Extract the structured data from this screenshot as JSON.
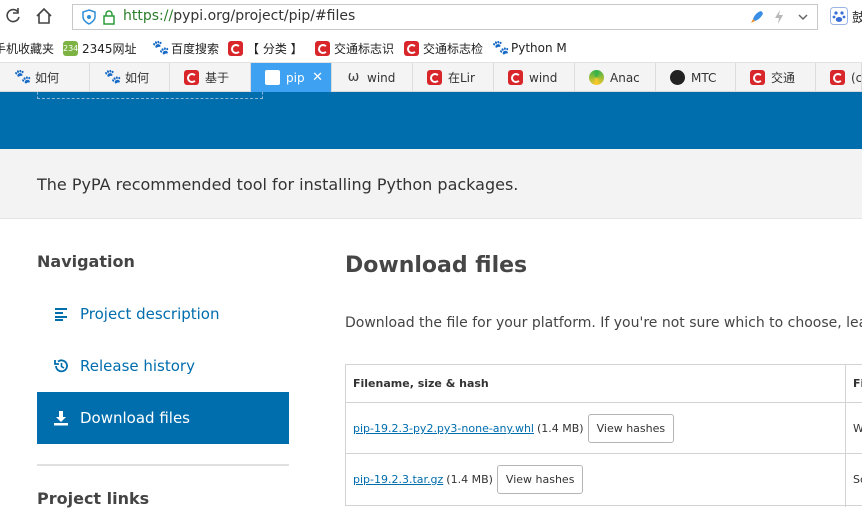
{
  "browser": {
    "url_protocol": "https://",
    "url_rest": "pypi.org/project/pip/#files",
    "right_edge_text": "鼓"
  },
  "bookmarks": [
    {
      "label": "手机收藏夹",
      "icon": "none"
    },
    {
      "label": "2345网址",
      "icon": "2345-icon"
    },
    {
      "label": "百度搜索",
      "icon": "baidu-paw-icon"
    },
    {
      "label": "【 分类 】",
      "icon": "csdn-icon"
    },
    {
      "label": "交通标志识",
      "icon": "csdn-icon"
    },
    {
      "label": "交通标志检",
      "icon": "csdn-icon"
    },
    {
      "label": "Python M",
      "icon": "baidu-paw-icon"
    }
  ],
  "tabs": [
    {
      "label": "如何",
      "icon": "baidu-paw-icon"
    },
    {
      "label": "如何",
      "icon": "baidu-paw-icon"
    },
    {
      "label": "基于",
      "icon": "csdn-icon"
    },
    {
      "label": "pip",
      "icon": "pypi-cube-icon"
    },
    {
      "label": "wind",
      "icon": "w-icon"
    },
    {
      "label": "在Lir",
      "icon": "csdn-icon"
    },
    {
      "label": "wind",
      "icon": "csdn-icon"
    },
    {
      "label": "Anac",
      "icon": "anaconda-icon"
    },
    {
      "label": "MTC",
      "icon": "github-icon"
    },
    {
      "label": "交通",
      "icon": "csdn-icon"
    },
    {
      "label": "(c",
      "icon": "csdn-icon"
    }
  ],
  "page": {
    "summary": "The PyPA recommended tool for installing Python packages.",
    "navigation": {
      "title": "Navigation",
      "items": [
        {
          "label": "Project description",
          "icon": "align-left-icon"
        },
        {
          "label": "Release history",
          "icon": "history-icon"
        },
        {
          "label": "Download files",
          "icon": "download-icon"
        }
      ]
    },
    "project_links_title": "Project links",
    "download": {
      "title": "Download files",
      "subtitle": "Download the file for your platform. If you're not sure which to choose, learn r",
      "columns": [
        "Filename, size & hash",
        "Fi"
      ],
      "rows": [
        {
          "filename": "pip-19.2.3-py2.py3-none-any.whl",
          "size": "(1.4 MB)",
          "button": "View hashes",
          "type": "W"
        },
        {
          "filename": "pip-19.2.3.tar.gz",
          "size": "(1.4 MB)",
          "button": "View hashes",
          "type": "Sc"
        }
      ]
    }
  },
  "colors": {
    "pypi_blue": "#006dad",
    "active_tab": "#3ea1f2",
    "band_gray": "#f3f3f3"
  }
}
